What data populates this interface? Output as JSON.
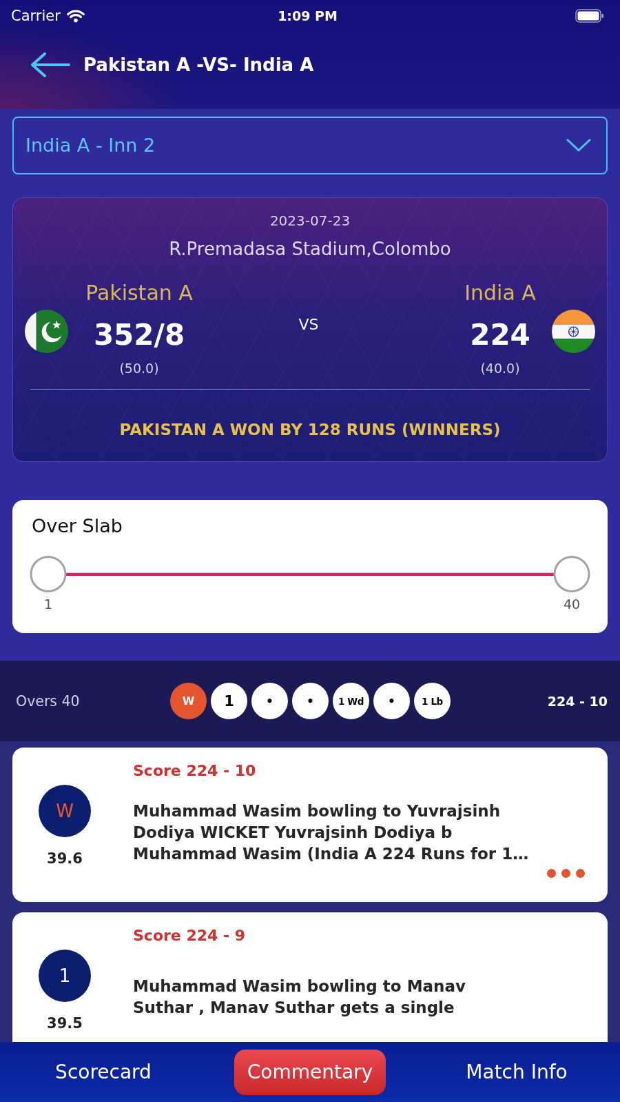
{
  "status_bar": {
    "carrier": "Carrier",
    "time": "1:09 PM"
  },
  "header": {
    "title": "Pakistan A -VS- India A"
  },
  "innings_select": {
    "value": "India A - Inn 2"
  },
  "match": {
    "date": "2023-07-23",
    "venue": "R.Premadasa Stadium,Colombo",
    "vs": "VS",
    "teams": [
      {
        "name": "Pakistan A",
        "score": "352/8",
        "overs": "(50.0)"
      },
      {
        "name": "India A",
        "score": "224",
        "overs": "(40.0)"
      }
    ],
    "result": "PAKISTAN A WON BY 128 RUNS (WINNERS)"
  },
  "over_slab": {
    "title": "Over Slab",
    "handles": [
      {
        "label": "1",
        "level": 0
      },
      {
        "label": "40",
        "level": 1
      }
    ]
  },
  "over_summary": {
    "label": "Overs 40",
    "balls": [
      {
        "text": "W",
        "kind": "wicket"
      },
      {
        "text": "1",
        "kind": "run"
      },
      {
        "text": "•",
        "kind": "dot"
      },
      {
        "text": "•",
        "kind": "dot"
      },
      {
        "text": "1 Wd",
        "kind": "extra"
      },
      {
        "text": "•",
        "kind": "dot"
      },
      {
        "text": "1 Lb",
        "kind": "extra"
      }
    ],
    "total": "224 - 10"
  },
  "commentary": [
    {
      "ball": "W",
      "kind": "wicket",
      "over": "39.6",
      "score": "Score 224 - 10",
      "text": "Muhammad Wasim bowling to Yuvrajsinh Dodiya WICKET Yuvrajsinh Dodiya b Muhammad Wasim (India A 224 Runs for 1…",
      "more": true
    },
    {
      "ball": "1",
      "kind": "run",
      "over": "39.5",
      "score": "Score 224 - 9",
      "text": "Muhammad Wasim bowling to Manav Suthar , Manav Suthar gets a single",
      "more": false
    }
  ],
  "tabs": [
    {
      "label": "Scorecard",
      "selected": false
    },
    {
      "label": "Commentary",
      "selected": true
    },
    {
      "label": "Match Info",
      "selected": false
    }
  ]
}
